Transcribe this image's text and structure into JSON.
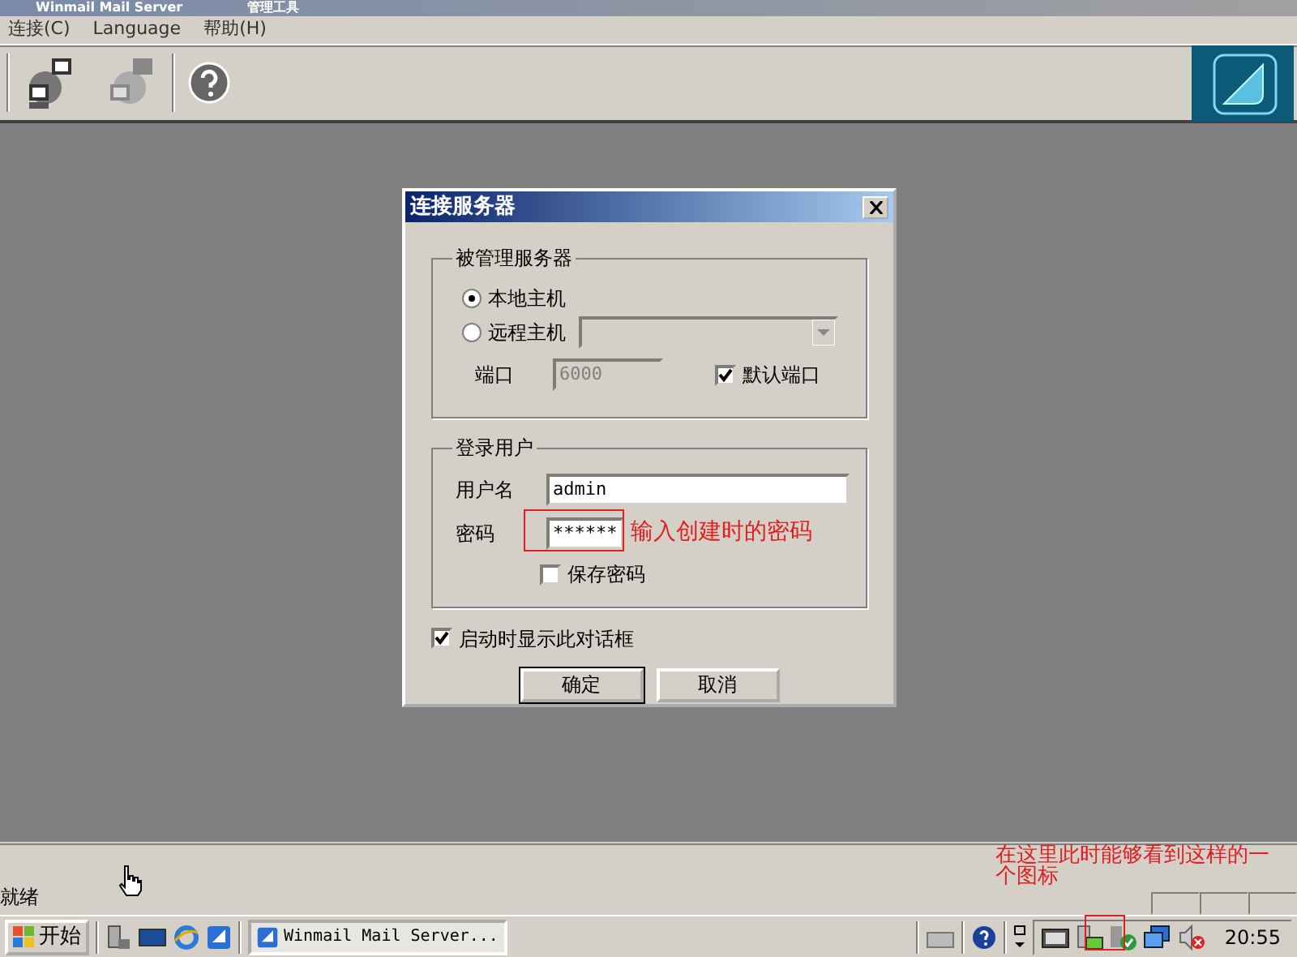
{
  "window": {
    "title": "Winmail Mail Server",
    "subtitle": "管理工具"
  },
  "menu": [
    {
      "label": "连接(C)"
    },
    {
      "label": "Language"
    },
    {
      "label": "帮助(H)"
    }
  ],
  "dialog": {
    "title": "连接服务器",
    "server_group": {
      "label": "被管理服务器",
      "radios": [
        {
          "label": "本地主机",
          "selected": true
        },
        {
          "label": "远程主机",
          "selected": false
        }
      ],
      "remote_host": {
        "disabled": true
      },
      "port_label": "端口",
      "port": {
        "value": "6000",
        "disabled": true
      },
      "default_port": {
        "label": "默认端口",
        "checked": true
      }
    },
    "login_group": {
      "label": "登录用户",
      "username_label": "用户名",
      "username": "admin",
      "password_label": "密码",
      "password": "******",
      "save_password": {
        "label": "保存密码",
        "checked": false
      }
    },
    "show_on_startup": {
      "label": "启动时显示此对话框",
      "checked": true
    },
    "buttons": [
      {
        "label": "确定",
        "default": true
      },
      {
        "label": "取消",
        "default": false
      }
    ]
  },
  "annotations": [
    {
      "text": "输入创建时的密码",
      "color": "#e02020"
    },
    {
      "text": "在这里此时能够看到这样的一个图标",
      "color": "#e02020"
    }
  ],
  "status_bar": {
    "text": "就绪"
  },
  "taskbar": {
    "start": "开始",
    "tasks": [
      {
        "label": "Winmail Mail Server...",
        "selected": true
      }
    ],
    "clock": "20:55"
  }
}
